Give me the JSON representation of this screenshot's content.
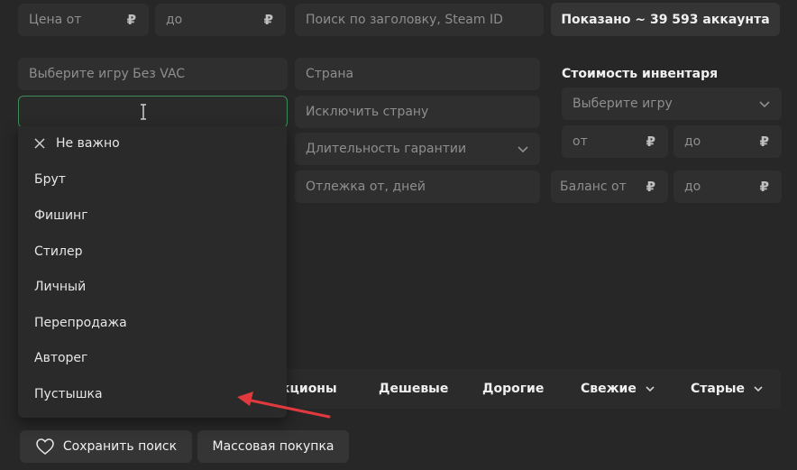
{
  "filters": {
    "price_from_placeholder": "Цена от",
    "price_to_placeholder": "до",
    "currency_symbol": "₽",
    "search_placeholder": "Поиск по заголовку, Steam ID",
    "shown_label": "Показано ~ 39 593 аккаунта",
    "game_no_vac_placeholder": "Выберите игру Без VAC",
    "country_placeholder": "Страна",
    "exclude_country_placeholder": "Исключить страну",
    "warranty_placeholder": "Длительность гарантии",
    "hold_days_placeholder": "Отлежка от, дней"
  },
  "inventory": {
    "heading": "Стоимость инвентаря",
    "game_placeholder": "Выберите игру",
    "from_placeholder": "от",
    "to_placeholder": "до",
    "balance_from_placeholder": "Баланс от",
    "balance_to_placeholder": "до"
  },
  "dropdown": {
    "none_label": "Не важно",
    "items": [
      "Брут",
      "Фишинг",
      "Стилер",
      "Личный",
      "Перепродажа",
      "Авторег",
      "Пустышка"
    ]
  },
  "sort": {
    "partial_label": "кционы",
    "cheap": "Дешевые",
    "expensive": "Дорогие",
    "fresh": "Свежие",
    "old": "Старые"
  },
  "actions": {
    "save_search": "Сохранить поиск",
    "bulk_purchase": "Массовая покупка"
  },
  "colors": {
    "background": "#272727",
    "field": "#2f2f2f",
    "active_border": "#3f8a5a",
    "annotation_arrow": "#e0393e"
  },
  "icons": {
    "clear": "close-icon",
    "chevron": "chevron-down-icon",
    "heart": "heart-icon",
    "cursor": "text-cursor-icon"
  }
}
